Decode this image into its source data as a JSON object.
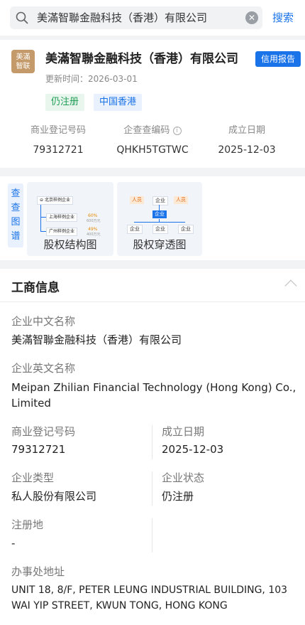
{
  "search": {
    "query": "美滿智聯金融科技（香港）有限公司",
    "clear_icon": "clear-circle-icon",
    "button_label": "搜索"
  },
  "company": {
    "logo_text": "美滿智联",
    "name": "美滿智聯金融科技（香港）有限公司",
    "credit_report_label": "信用报告",
    "update_label": "更新时间：",
    "update_date": "2026-03-01",
    "tags": [
      "仍注册",
      "中国香港"
    ],
    "stats": [
      {
        "label": "商业登记号码",
        "value": "79312721"
      },
      {
        "label": "企查查编码",
        "value": "QHKH5TGTWC"
      },
      {
        "label": "成立日期",
        "value": "2025-12-03"
      }
    ]
  },
  "graphs": {
    "side_label": "查查图谱",
    "structure": {
      "title": "股权结构图",
      "nodes": [
        "北京样例企业",
        "上海样例企业",
        "广州样例企业"
      ],
      "pcts": [
        "60%",
        "49%"
      ],
      "subs": [
        "600万元",
        "400万元"
      ]
    },
    "penetration": {
      "title": "股权穿透图",
      "people": [
        "人员",
        "人员"
      ],
      "companies": [
        "企业",
        "企业",
        "企业",
        "企业",
        "企业"
      ]
    }
  },
  "business": {
    "title": "工商信息",
    "fields": {
      "cn_name": {
        "label": "企业中文名称",
        "value": "美滿智聯金融科技（香港）有限公司"
      },
      "en_name": {
        "label": "企业英文名称",
        "value_line1": "Meipan Zhilian Financial Technology (Hong Kong) Co.,",
        "value_line2": "Limited"
      },
      "reg_no": {
        "label": "商业登记号码",
        "value": "79312721"
      },
      "est_date": {
        "label": "成立日期",
        "value": "2025-12-03"
      },
      "type": {
        "label": "企业类型",
        "value": "私人股份有限公司"
      },
      "status": {
        "label": "企业状态",
        "value": "仍注册"
      },
      "reg_place": {
        "label": "注册地",
        "value": "-"
      },
      "office": {
        "label": "办事处地址",
        "value_line1": "UNIT 18, 8/F, PETER LEUNG INDUSTRIAL BUILDING, 103",
        "value_line2": "WAI YIP STREET, KWUN TONG, HONG KONG"
      }
    }
  }
}
